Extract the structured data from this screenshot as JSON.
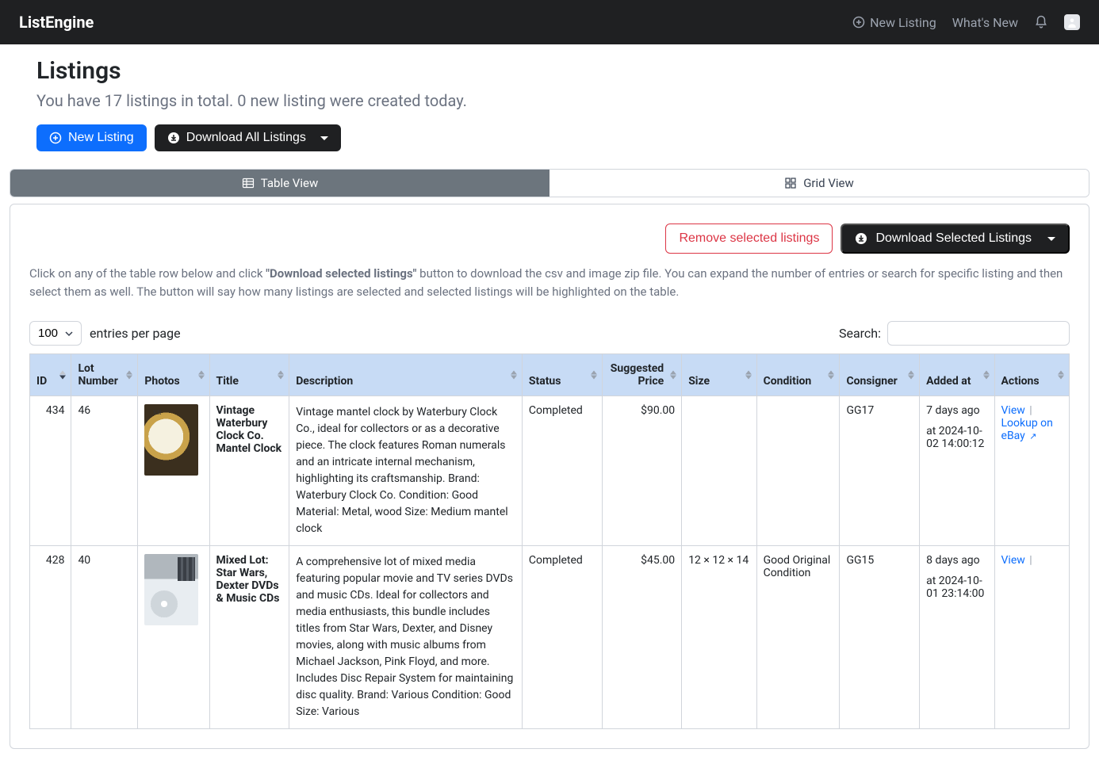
{
  "header": {
    "brand": "ListEngine",
    "new_listing": "New Listing",
    "whats_new": "What's New"
  },
  "page": {
    "title": "Listings",
    "subtitle": "You have 17 listings in total. 0 new listing were created today.",
    "btn_new_listing": "New Listing",
    "btn_download_all": "Download All Listings"
  },
  "tabs": {
    "table_view": "Table View",
    "grid_view": "Grid View"
  },
  "toolbar": {
    "remove_selected": "Remove selected listings",
    "download_selected": "Download Selected Listings"
  },
  "help": {
    "prefix": "Click on any of the table row below and click ",
    "bold": "\"Download selected listings\"",
    "suffix": " button to download the csv and image zip file. You can expand the number of entries or search for specific listing and then select them as well. The button will say how many listings are selected and selected listings will be highlighted on the table."
  },
  "controls": {
    "entries_value": "100",
    "entries_label": "entries per page",
    "search_label": "Search:"
  },
  "columns": {
    "id": "ID",
    "lot": "Lot Number",
    "photos": "Photos",
    "title": "Title",
    "description": "Description",
    "status": "Status",
    "price": "Suggested Price",
    "size": "Size",
    "condition": "Condition",
    "consigner": "Consigner",
    "added": "Added at",
    "actions": "Actions"
  },
  "rows": [
    {
      "id": "434",
      "lot": "46",
      "title": "Vintage Waterbury Clock Co. Mantel Clock",
      "description": "Vintage mantel clock by Waterbury Clock Co., ideal for collectors or as a decorative piece. The clock features Roman numerals and an intricate internal mechanism, highlighting its craftsmanship. Brand: Waterbury Clock Co. Condition: Good Material: Metal, wood Size: Medium mantel clock",
      "status": "Completed",
      "price": "$90.00",
      "size": "",
      "condition": "",
      "consigner": "GG17",
      "added_rel": "7 days ago",
      "added_abs": "at 2024-10-02 14:00:12",
      "action_view": "View",
      "action_ebay": "Lookup on eBay",
      "show_ebay": true,
      "thumb": "clock"
    },
    {
      "id": "428",
      "lot": "40",
      "title": "Mixed Lot: Star Wars, Dexter DVDs & Music CDs",
      "description": "A comprehensive lot of mixed media featuring popular movie and TV series DVDs and music CDs. Ideal for collectors and media enthusiasts, this bundle includes titles from Star Wars, Dexter, and Disney movies, along with music albums from Michael Jackson, Pink Floyd, and more. Includes Disc Repair System for maintaining disc quality. Brand: Various Condition: Good Size: Various",
      "status": "Completed",
      "price": "$45.00",
      "size": "12 × 12 × 14",
      "condition": "Good Original Condition",
      "consigner": "GG15",
      "added_rel": "8 days ago",
      "added_abs": "at 2024-10-01 23:14:00",
      "action_view": "View",
      "action_ebay": "",
      "show_ebay": false,
      "thumb": "dvds"
    }
  ]
}
